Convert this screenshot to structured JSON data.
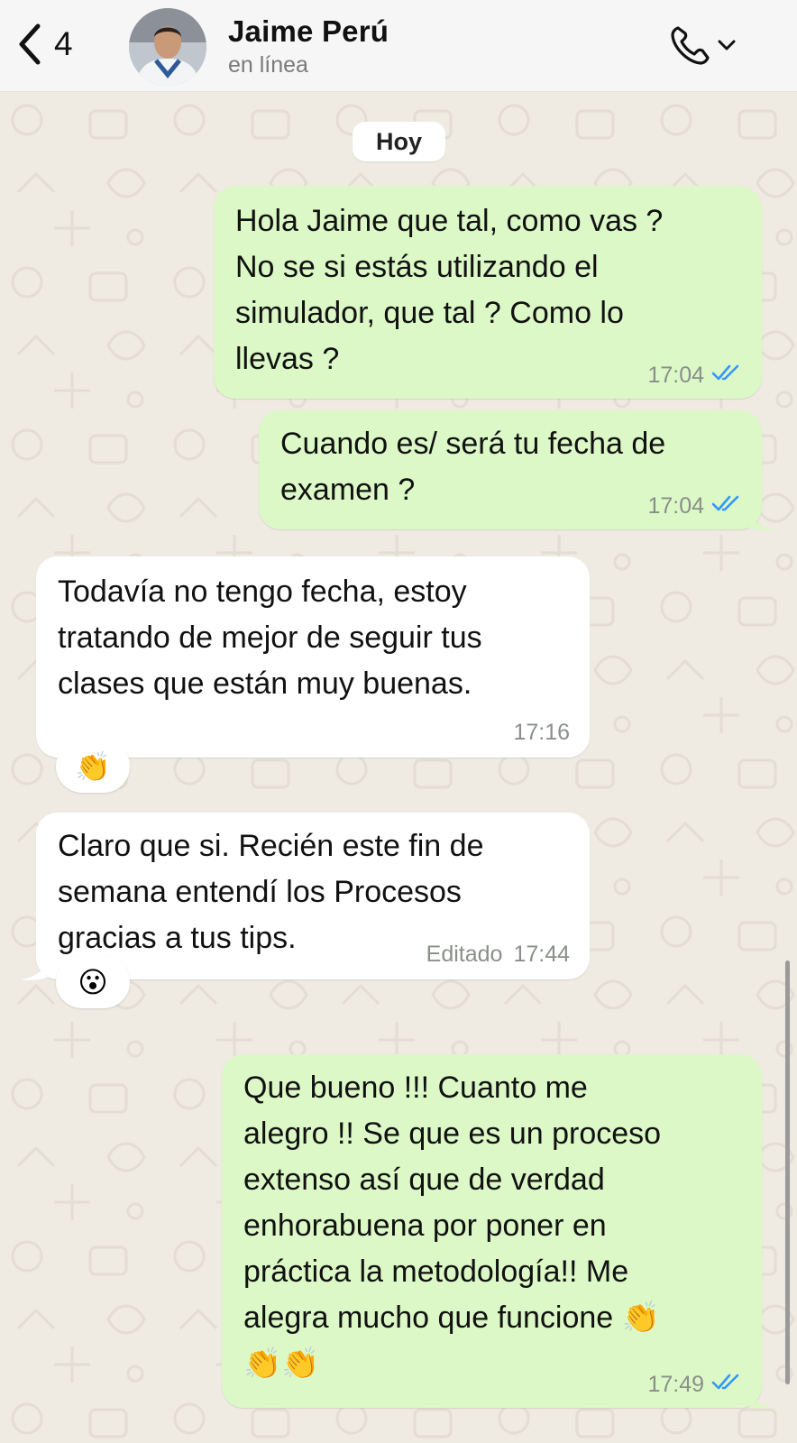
{
  "header": {
    "back_count": "4",
    "contact_name": "Jaime Perú",
    "status": "en línea",
    "back_icon": "chevron-left-icon",
    "call_icon": "phone-icon",
    "dropdown_icon": "chevron-down-icon"
  },
  "chat": {
    "date_label": "Hoy",
    "messages": [
      {
        "direction": "outgoing",
        "lines": [
          "Hola Jaime que tal, como vas ?",
          "No se si estás utilizando el",
          "simulador, que tal ? Como lo",
          "llevas ?"
        ],
        "time": "17:04",
        "status": "read"
      },
      {
        "direction": "outgoing",
        "lines": [
          "Cuando es/ será tu fecha de",
          "examen ?"
        ],
        "time": "17:04",
        "status": "read"
      },
      {
        "direction": "incoming",
        "lines": [
          "Todavía no tengo fecha, estoy",
          "tratando de mejor de seguir tus",
          "clases que están muy buenas."
        ],
        "time": "17:16",
        "reaction": "👏"
      },
      {
        "direction": "incoming",
        "lines": [
          "Claro que si.  Recién este fin de",
          "semana entendí los Procesos",
          "gracias a tus tips."
        ],
        "edited_label": "Editado",
        "time": "17:44",
        "reaction": "😮"
      },
      {
        "direction": "outgoing",
        "lines": [
          "Que bueno !!! Cuanto me",
          "alegro !! Se que es un proceso",
          "extenso así que de verdad",
          "enhorabuena por poner en",
          "práctica la metodología!! Me",
          "alegra mucho que funcione 👏",
          "👏👏"
        ],
        "time": "17:49",
        "status": "read"
      }
    ]
  },
  "colors": {
    "outgoing_bubble": "#dcf8c6",
    "incoming_bubble": "#ffffff",
    "chat_background": "#efeae2",
    "read_ticks": "#3497f9",
    "header_background": "#f6f6f6"
  }
}
